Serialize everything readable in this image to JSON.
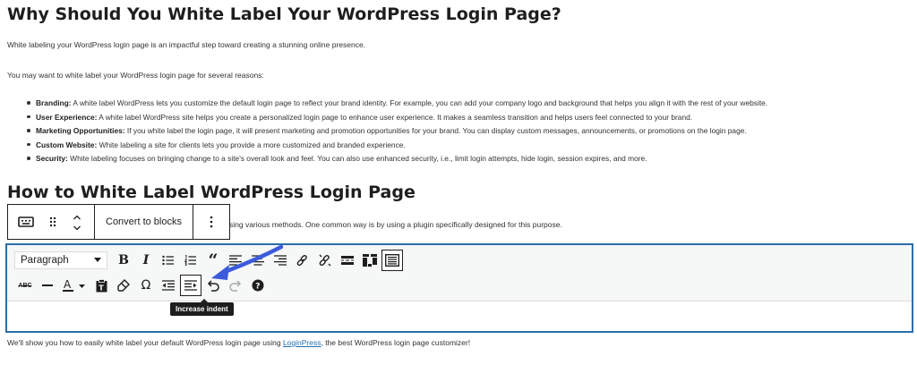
{
  "heading1": "Why Should You White Label Your WordPress Login Page?",
  "intro": "White labeling your WordPress login page is an impactful step toward creating a stunning online presence.",
  "reasons_intro": "You may want to white label your WordPress login page for several reasons:",
  "reasons": [
    {
      "term": "Branding:",
      "text": " A white label WordPress lets you customize the default login page to reflect your brand identity. For example, you can add your company logo and background that helps you align it with the rest of your website."
    },
    {
      "term": "User Experience:",
      "text": " A white label WordPress site helps you create a personalized login page to enhance user experience. It makes a seamless transition and helps users feel connected to your brand."
    },
    {
      "term": "Marketing Opportunities:",
      "text": " If you white label the login page, it will present marketing and promotion opportunities for your brand. You can display custom messages, announcements, or promotions on the login page."
    },
    {
      "term": "Custom Website:",
      "text": " White labeling a site for clients lets you provide a more customized and branded experience."
    },
    {
      "term": "Security:",
      "text": " White labeling focuses on bringing change to a site's overall look and feel. You can also use enhanced security, i.e., limit login attempts, hide login, session expires, and more."
    }
  ],
  "heading2": "How to White Label WordPress Login Page",
  "partial_paragraph": "sing various methods. One common way is by using a plugin specifically designed for this purpose.",
  "block_toolbar": {
    "convert_label": "Convert to blocks",
    "icons": [
      "keyboard-icon",
      "drag-handle-icon",
      "move-up-icon",
      "move-down-icon",
      "more-options-icon"
    ]
  },
  "editor": {
    "format_select": "Paragraph",
    "row1_icons": [
      "bold-icon",
      "italic-icon",
      "bulleted-list-icon",
      "numbered-list-icon",
      "blockquote-icon",
      "align-left-icon",
      "align-center-icon",
      "align-right-icon",
      "insert-link-icon",
      "remove-link-icon",
      "read-more-icon",
      "toolbar-toggle-icon",
      "fullscreen-icon"
    ],
    "row2_icons": [
      "strikethrough-icon",
      "horizontal-line-icon",
      "text-color-icon",
      "paste-as-text-icon",
      "clear-formatting-icon",
      "special-character-icon",
      "decrease-indent-icon",
      "increase-indent-icon",
      "undo-icon",
      "redo-icon",
      "keyboard-shortcuts-icon"
    ],
    "hovered": "increase-indent-icon"
  },
  "tooltip": "Increase indent",
  "bottom": {
    "before": "We'll show you how to easily white label your default WordPress login page using ",
    "link": "LoginPress",
    "after": ", the best WordPress login page customizer!"
  },
  "colors": {
    "editor_border": "#2a6fa8",
    "arrow": "#3b5bdb",
    "link": "#2271b1",
    "tooltip_bg": "#1e1e1e"
  }
}
